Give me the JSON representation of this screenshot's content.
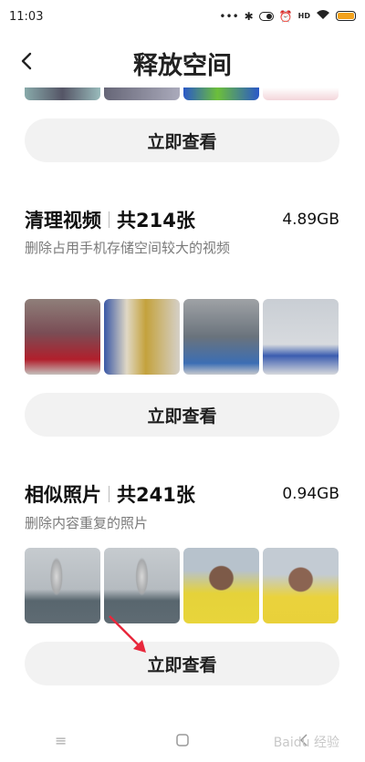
{
  "status": {
    "time": "11:03",
    "icons": [
      "dots-icon",
      "bluetooth-icon",
      "toggle-icon",
      "alarm-icon",
      "hd-icon",
      "wifi-icon",
      "battery-icon"
    ],
    "hd_label": "HD"
  },
  "header": {
    "title": "释放空间",
    "back_icon": "chevron-left-icon"
  },
  "top_section": {
    "button_label": "立即查看"
  },
  "video_section": {
    "title": "清理视频",
    "count": "共214张",
    "size": "4.89GB",
    "description": "删除占用手机存储空间较大的视频",
    "button_label": "立即查看"
  },
  "similar_section": {
    "title": "相似照片",
    "count": "共241张",
    "size": "0.94GB",
    "description": "删除内容重复的照片",
    "button_label": "立即查看"
  },
  "navbar": {
    "items": [
      "menu-icon",
      "home-icon",
      "back-icon"
    ]
  },
  "watermark": "Baidu 经验",
  "colors": {
    "accent": "#e8283c",
    "button_bg": "#f2f2f2",
    "battery": "#f3a21c"
  }
}
